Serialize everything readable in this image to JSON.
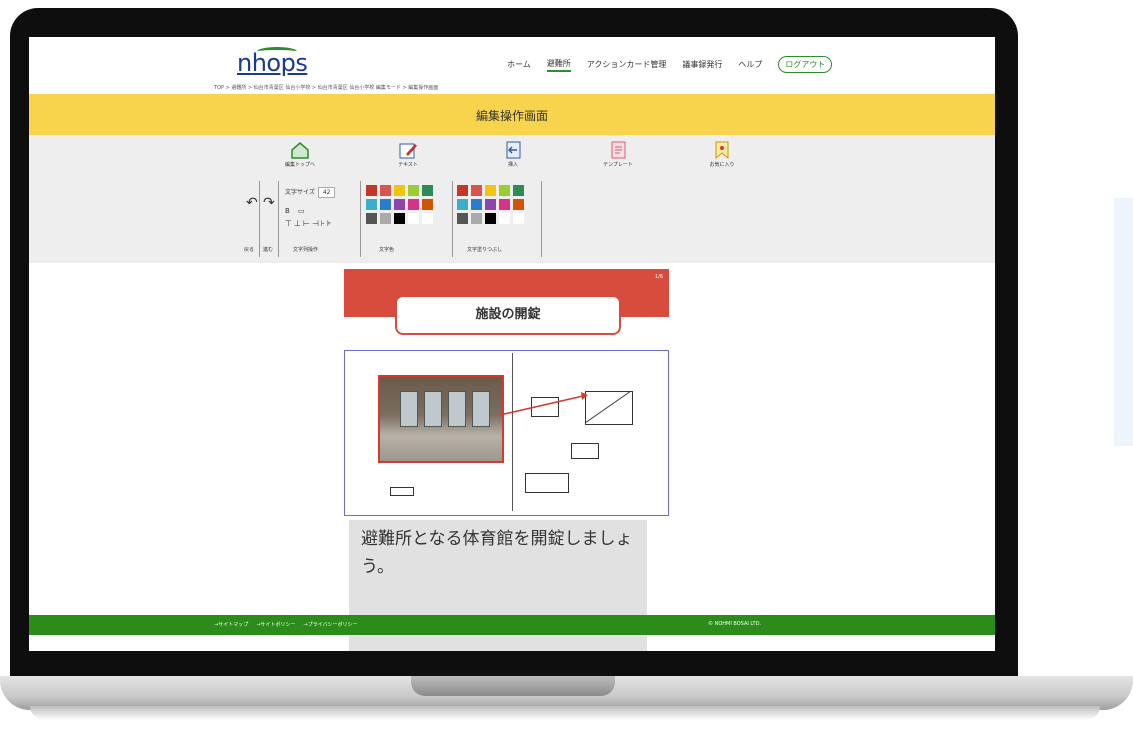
{
  "header": {
    "logo": "nhops",
    "nav": [
      {
        "label": "ホーム"
      },
      {
        "label": "避難所"
      },
      {
        "label": "アクションカード管理"
      },
      {
        "label": "議事録発行"
      },
      {
        "label": "ヘルプ"
      }
    ],
    "logout_label": "ログアウト"
  },
  "breadcrumb": "TOP > 避難所 > 仙台市青葉区 仙台小学校 > 仙台市青葉区 仙台小学校 編集モード > 編集操作画面",
  "page_title": "編集操作画面",
  "toolbar": {
    "tools": [
      {
        "label": "編集トップへ",
        "icon": "home-icon"
      },
      {
        "label": "テキスト",
        "icon": "pencil-icon"
      },
      {
        "label": "挿入",
        "icon": "insert-icon"
      },
      {
        "label": "テンプレート",
        "icon": "template-icon"
      },
      {
        "label": "お気に入り",
        "icon": "bookmark-icon"
      }
    ],
    "undo_label": "戻る",
    "redo_label": "進む",
    "font_size_label": "文字サイズ",
    "font_size_value": "42",
    "string_op_label": "文字列操作",
    "text_color_label": "文字色",
    "text_fill_label": "文字塗りつぶし",
    "swatch_colors": [
      "#c0392b",
      "#c0392b",
      "#f1c40f",
      "#9acd32",
      "#2e8b57",
      "#3ab0c8",
      "#2c7bd0",
      "#8e44ad",
      "#d63384",
      "#d35400",
      "#555555",
      "#aaaaaa",
      "#000000",
      "#ffffff",
      "#ffffff"
    ]
  },
  "card": {
    "page_indicator": "1/6",
    "title": "施設の開錠",
    "caption": "避難所となる体育館を開錠しましょう。"
  },
  "footer": {
    "links": [
      "→サイトマップ",
      "→サイトポリシー",
      "→プライバシーポリシー"
    ],
    "copyright": "© NOHMI BOSAI LTD."
  }
}
